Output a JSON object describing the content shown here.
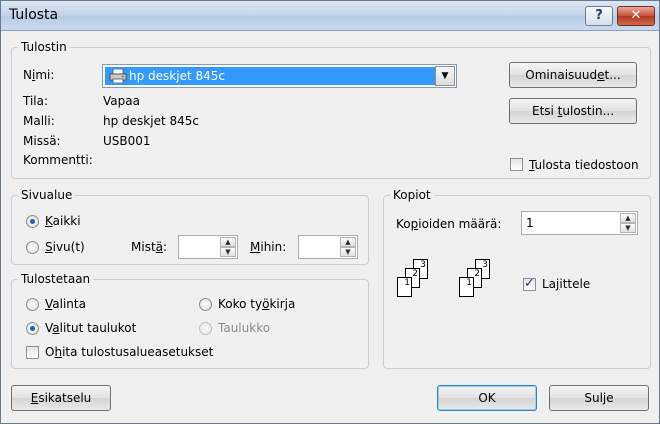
{
  "window": {
    "title": "Tulosta",
    "help_label": "?",
    "close_label": "✕"
  },
  "printer": {
    "group_label": "Tulostin",
    "name_label_pre": "N",
    "name_label_u": "i",
    "name_label_post": "mi:",
    "selected_printer": "hp deskjet 845c",
    "status_label": "Tila:",
    "status_value": "Vapaa",
    "model_label": "Malli:",
    "model_value": "hp deskjet 845c",
    "location_label": "Missä:",
    "location_value": "USB001",
    "comment_label": "Kommentti:",
    "comment_value": "",
    "properties_pre": "Ominaisuud",
    "properties_u": "e",
    "properties_post": "t...",
    "find_pre": "Etsi ",
    "find_u": "t",
    "find_post": "ulostin...",
    "print_to_file_u": "T",
    "print_to_file_post": "ulosta tiedostoon",
    "print_to_file_checked": false
  },
  "range": {
    "group_label": "Sivualue",
    "all_u": "K",
    "all_post": "aikki",
    "pages_u": "S",
    "pages_post": "ivu(t)",
    "from_pre": "Mist",
    "from_u": "ä",
    "from_post": ":",
    "from_value": "",
    "to_u": "M",
    "to_post": "ihin:",
    "to_value": ""
  },
  "print_what": {
    "group_label": "Tulostetaan",
    "selection_u": "V",
    "selection_post": "alinta",
    "workbook_pre": "Koko ty",
    "workbook_u": "ö",
    "workbook_post": "kirja",
    "sheets_pre": "V",
    "sheets_u": "a",
    "sheets_post": "litut taulukot",
    "table_label": "Taulukko",
    "ignore_pre": "O",
    "ignore_u": "h",
    "ignore_post": "ita tulostusalueasetukset",
    "ignore_checked": false
  },
  "copies": {
    "group_label": "Kopiot",
    "count_pre": "Ko",
    "count_u": "p",
    "count_post": "ioiden määrä:",
    "count_value": "1",
    "collate_pre": "La",
    "collate_u": "j",
    "collate_post": "ittele",
    "collate_checked": true,
    "collate_page_numbers": [
      "1",
      "2",
      "3"
    ]
  },
  "footer": {
    "preview_u": "E",
    "preview_post": "sikatselu",
    "ok_label": "OK",
    "close_label": "Sulje"
  }
}
